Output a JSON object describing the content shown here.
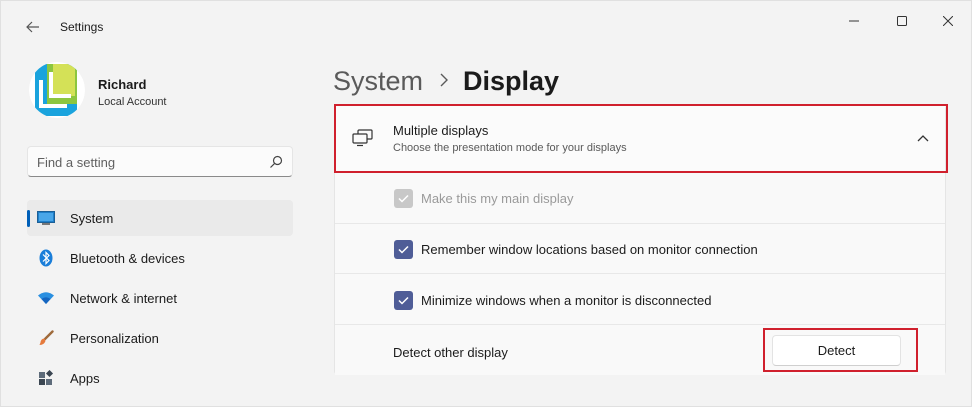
{
  "window": {
    "title": "Settings",
    "controls": [
      "minimize-icon",
      "maximize-icon",
      "close-icon"
    ]
  },
  "user": {
    "name": "Richard",
    "account_type": "Local Account"
  },
  "search": {
    "placeholder": "Find a setting"
  },
  "sidebar": {
    "items": [
      {
        "label": "System",
        "icon": "system-icon",
        "selected": true
      },
      {
        "label": "Bluetooth & devices",
        "icon": "bluetooth-icon",
        "selected": false
      },
      {
        "label": "Network & internet",
        "icon": "wifi-icon",
        "selected": false
      },
      {
        "label": "Personalization",
        "icon": "brush-icon",
        "selected": false
      },
      {
        "label": "Apps",
        "icon": "apps-icon",
        "selected": false
      }
    ]
  },
  "header": {
    "parent": "System",
    "current": "Display"
  },
  "multiple_displays": {
    "title": "Multiple displays",
    "subtitle": "Choose the presentation mode for your displays",
    "expanded": true,
    "options": [
      {
        "label": "Make this my main display",
        "checked": true,
        "disabled": true
      },
      {
        "label": "Remember window locations based on monitor connection",
        "checked": true,
        "disabled": false
      },
      {
        "label": "Minimize windows when a monitor is disconnected",
        "checked": true,
        "disabled": false
      }
    ],
    "detect_label": "Detect other display",
    "detect_button": "Detect"
  },
  "colors": {
    "accent": "#005fb8",
    "checkbox": "#4f5d97",
    "highlight": "#d0202d"
  }
}
